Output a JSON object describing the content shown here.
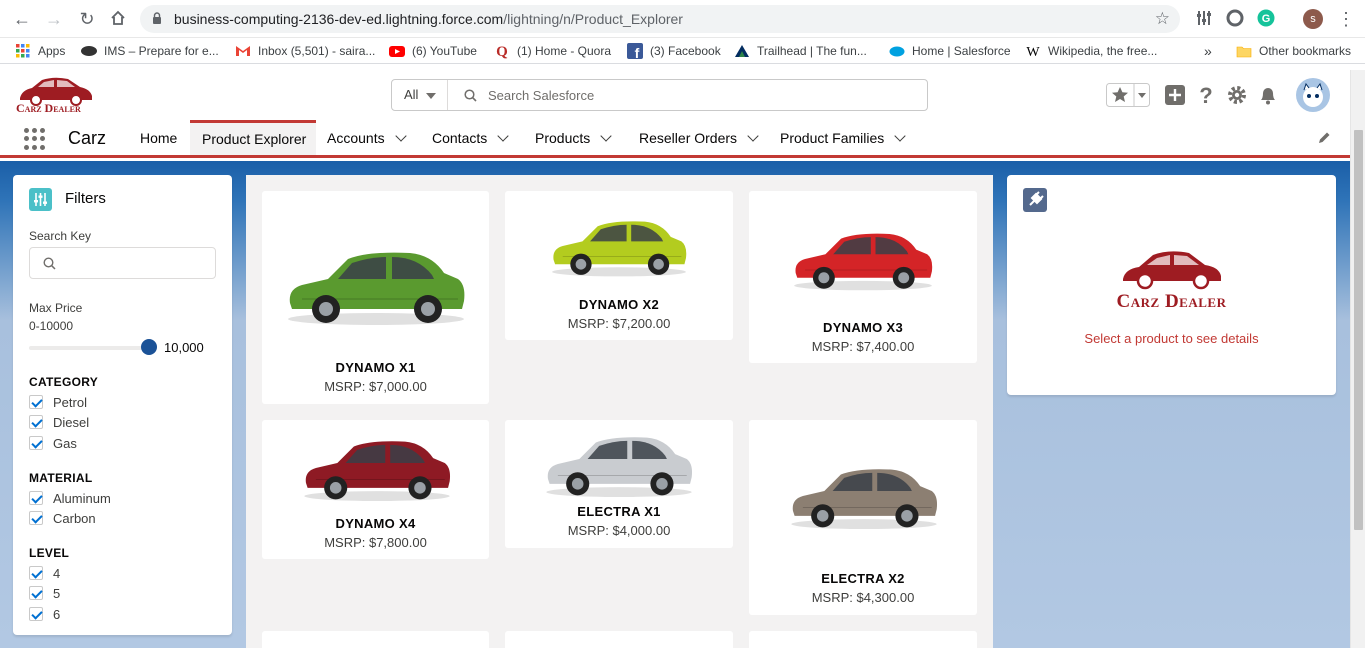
{
  "browser": {
    "url_host": "business-computing-2136-dev-ed.lightning.force.com",
    "url_path": "/lightning/n/Product_Explorer",
    "profile_initial": "s",
    "bookmarks": [
      {
        "label": "Apps",
        "icon": "apps-grid-icon"
      },
      {
        "label": "IMS – Prepare for e...",
        "icon": "ims-icon"
      },
      {
        "label": "Inbox (5,501) - saira...",
        "icon": "gmail-icon"
      },
      {
        "label": "(6) YouTube",
        "icon": "youtube-icon"
      },
      {
        "label": "(1) Home - Quora",
        "icon": "quora-icon"
      },
      {
        "label": "(3) Facebook",
        "icon": "facebook-icon"
      },
      {
        "label": "Trailhead | The fun...",
        "icon": "trailhead-icon"
      },
      {
        "label": "Home | Salesforce",
        "icon": "salesforce-icon"
      },
      {
        "label": "Wikipedia, the free...",
        "icon": "wikipedia-icon"
      }
    ],
    "more": "»",
    "other_bookmarks": "Other bookmarks"
  },
  "header": {
    "logo_text": "Carz Dealer",
    "search_scope": "All",
    "search_placeholder": "Search Salesforce"
  },
  "nav": {
    "app_name": "Carz",
    "items": [
      {
        "label": "Home",
        "dropdown": false
      },
      {
        "label": "Product Explorer",
        "dropdown": false,
        "active": true
      },
      {
        "label": "Accounts",
        "dropdown": true
      },
      {
        "label": "Contacts",
        "dropdown": true
      },
      {
        "label": "Products",
        "dropdown": true
      },
      {
        "label": "Reseller Orders",
        "dropdown": true
      },
      {
        "label": "Product Families",
        "dropdown": true
      }
    ]
  },
  "filters": {
    "title": "Filters",
    "search_key_label": "Search Key",
    "search_key_value": "",
    "max_price_label": "Max Price",
    "max_price_range": "0-10000",
    "max_price_value": "10,000",
    "max_price_fraction": 1.0,
    "category_label": "CATEGORY",
    "categories": [
      "Petrol",
      "Diesel",
      "Gas"
    ],
    "material_label": "MATERIAL",
    "materials": [
      "Aluminum",
      "Carbon"
    ],
    "level_label": "LEVEL",
    "levels": [
      "4",
      "5",
      "6"
    ]
  },
  "products": [
    {
      "name": "DYNAMO X1",
      "price": "MSRP: $7,000.00",
      "color": "#5a9a2f"
    },
    {
      "name": "DYNAMO X2",
      "price": "MSRP: $7,200.00",
      "color": "#b3cc1f"
    },
    {
      "name": "DYNAMO X3",
      "price": "MSRP: $7,400.00",
      "color": "#d42427"
    },
    {
      "name": "DYNAMO X4",
      "price": "MSRP: $7,800.00",
      "color": "#8e1a24"
    },
    {
      "name": "ELECTRA X1",
      "price": "MSRP: $4,000.00",
      "color": "#c9ccd0"
    },
    {
      "name": "ELECTRA X2",
      "price": "MSRP: $4,300.00",
      "color": "#8c7f72"
    }
  ],
  "details": {
    "brand": "Carz Dealer",
    "message": "Select a product to see details"
  },
  "colors": {
    "salesforce_red": "#c23934",
    "brand_red": "#9e1c22",
    "slider_blue": "#1b5297",
    "filters_icon": "#4bc0c8"
  }
}
